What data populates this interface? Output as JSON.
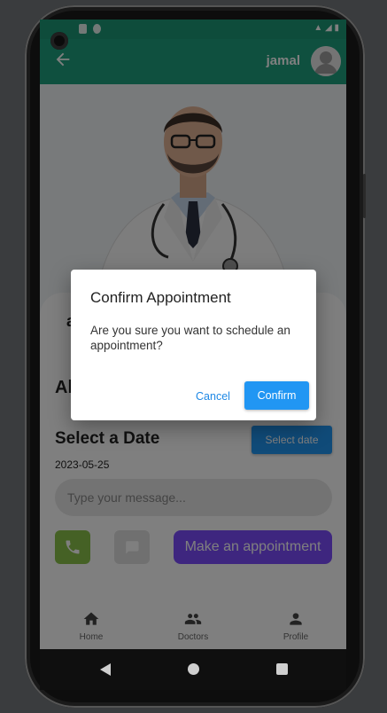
{
  "status_bar": {
    "time": ""
  },
  "app_bar": {
    "back_icon": "arrow-left-icon",
    "username": "jamal",
    "avatar_icon": "person-avatar-icon"
  },
  "doctor_card": {
    "name_initial": "a",
    "about_title": "Ab",
    "select_date_title": "Select a Date",
    "select_date_button": "Select date",
    "selected_date": "2023-05-25"
  },
  "message": {
    "placeholder": "Type your message..."
  },
  "actions": {
    "call_icon": "phone-icon",
    "chat_icon": "chat-bubble-icon",
    "appointment_label": "Make an appointment"
  },
  "bottom_nav": {
    "items": [
      {
        "label": "Home",
        "icon": "home-icon"
      },
      {
        "label": "Doctors",
        "icon": "people-icon"
      },
      {
        "label": "Profile",
        "icon": "person-icon"
      }
    ]
  },
  "dialog": {
    "title": "Confirm Appointment",
    "message": "Are you sure you want to schedule an appointment?",
    "cancel_label": "Cancel",
    "confirm_label": "Confirm"
  },
  "colors": {
    "primary": "#1fa07e",
    "accent_blue": "#2196f3",
    "purple": "#7c4dff",
    "green": "#8bc34a"
  }
}
